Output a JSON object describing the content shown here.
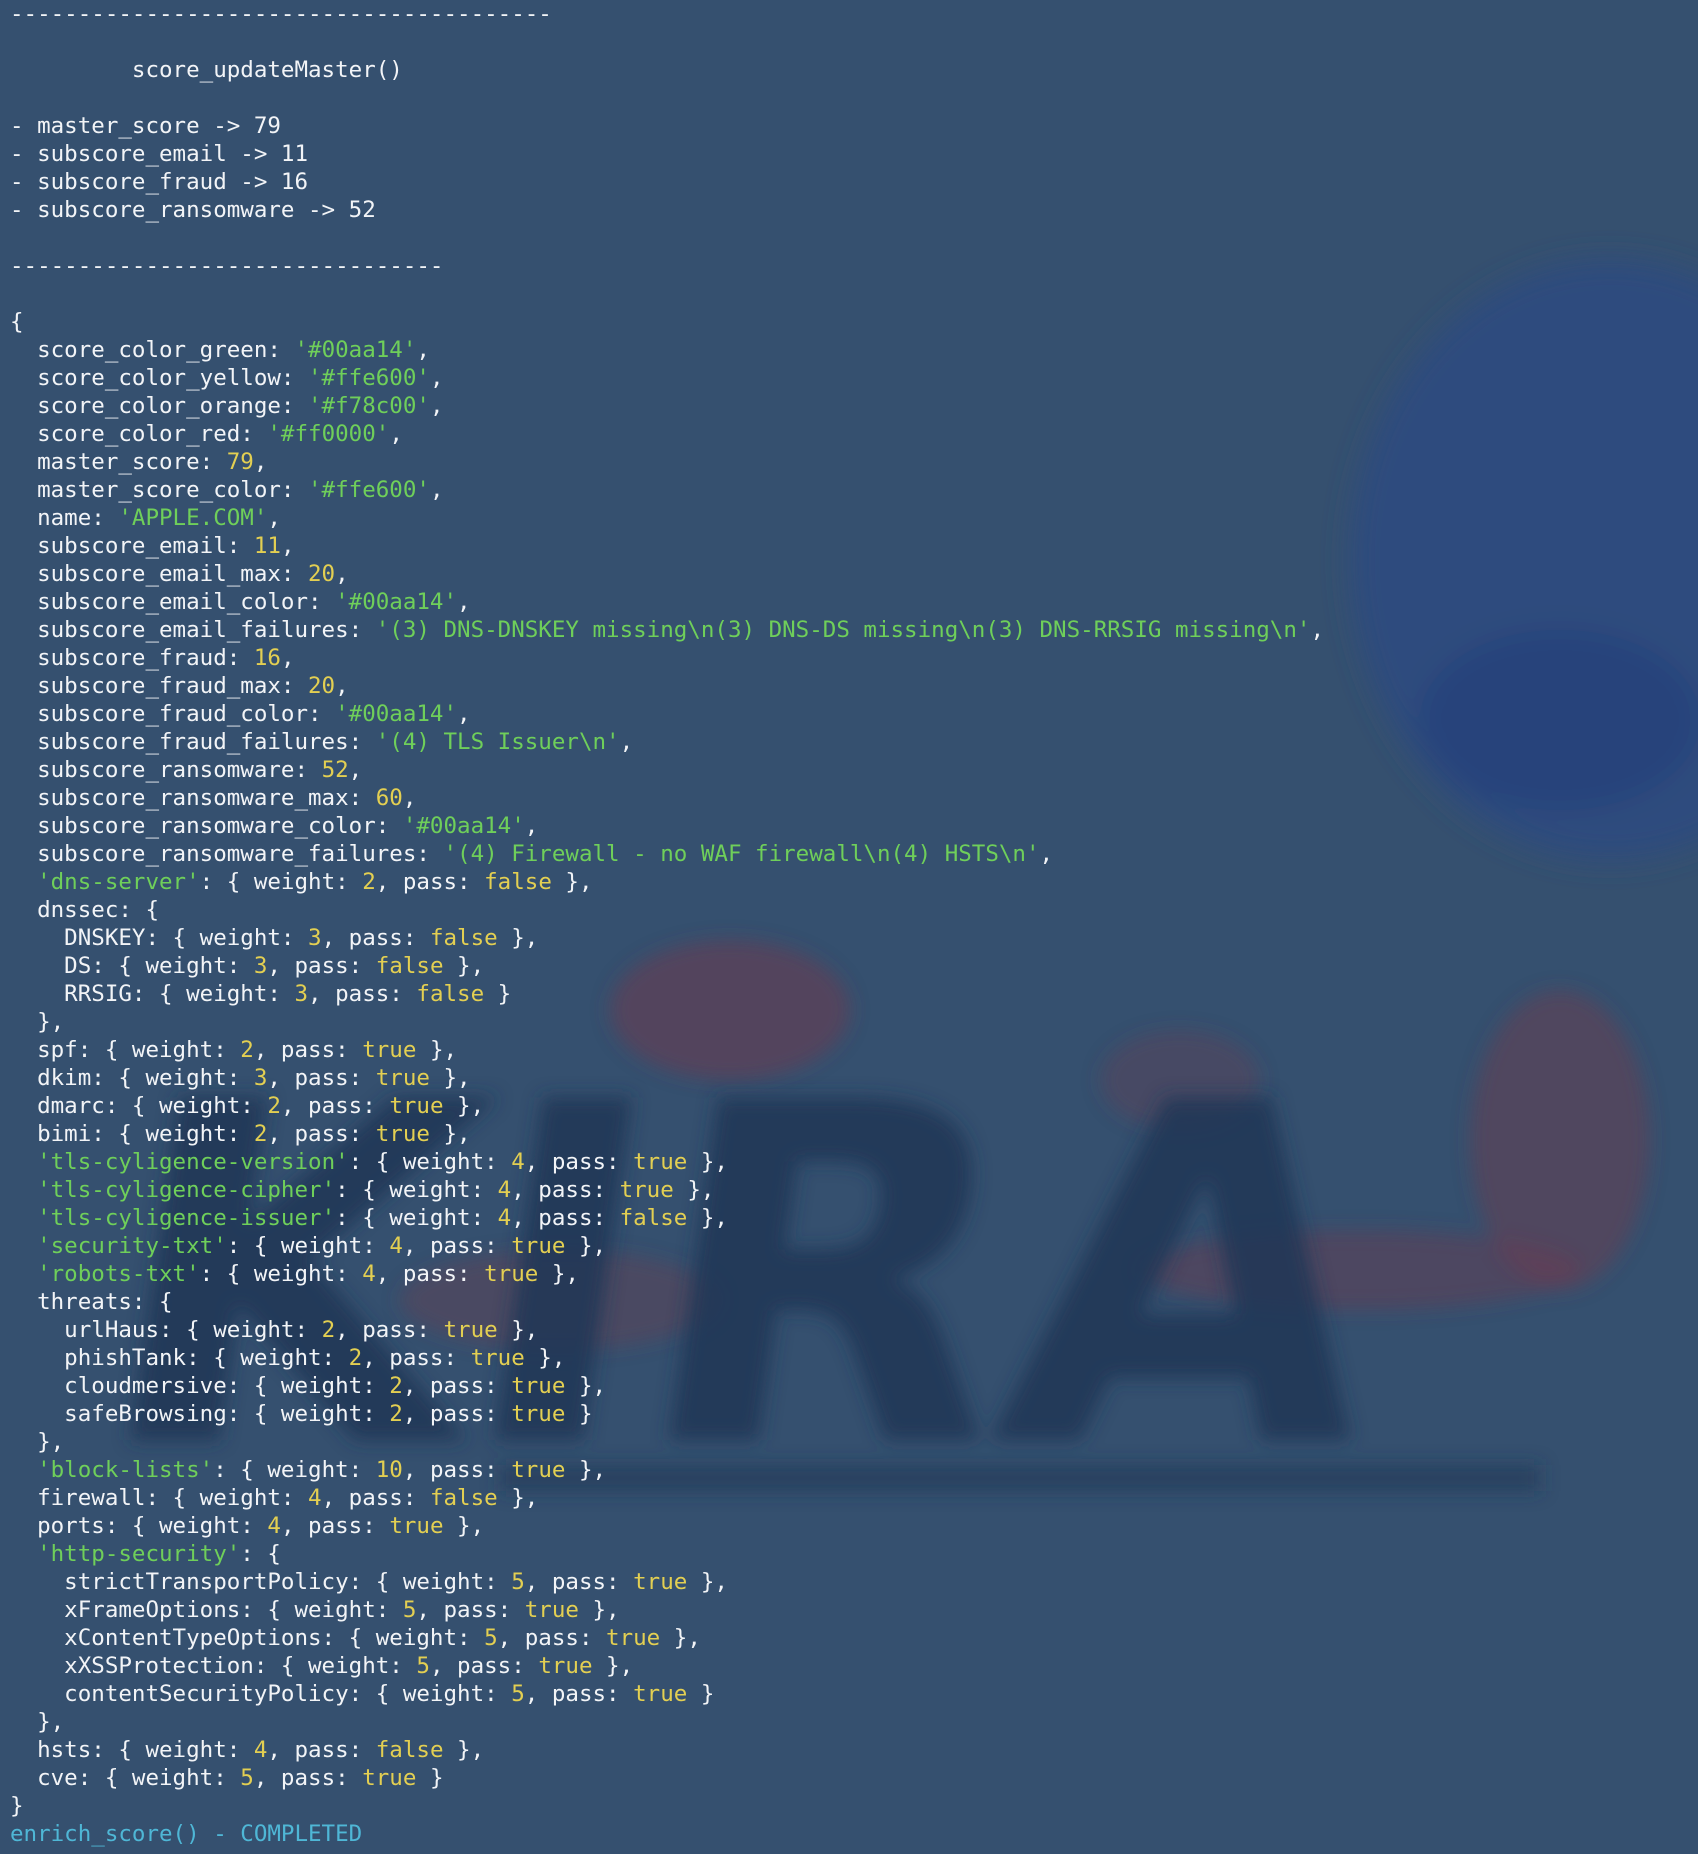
{
  "background": {
    "color": "#35506f",
    "watermark_text": "KIRA"
  },
  "colors": {
    "text": "#f2f4f7",
    "string": "#6fcf5a",
    "number": "#e3cf52",
    "status": "#4fb7d6"
  },
  "lines": [
    {
      "segments": [
        {
          "t": "punc",
          "v": "----------------------------------------"
        }
      ]
    },
    {
      "segments": [
        {
          "t": "punc",
          "v": "         score_updateMaster()"
        }
      ]
    },
    {
      "segments": [
        {
          "t": "punc",
          "v": "- master_score -> 79"
        }
      ]
    },
    {
      "segments": [
        {
          "t": "punc",
          "v": "- subscore_email -> 11"
        }
      ]
    },
    {
      "segments": [
        {
          "t": "punc",
          "v": "- subscore_fraud -> 16"
        }
      ]
    },
    {
      "segments": [
        {
          "t": "punc",
          "v": "- subscore_ransomware -> 52"
        }
      ]
    },
    {
      "segments": [
        {
          "t": "punc",
          "v": "--------------------------------"
        }
      ]
    },
    {
      "segments": [
        {
          "t": "punc",
          "v": "{"
        }
      ]
    },
    {
      "segments": [
        {
          "t": "key",
          "v": "  score_color_green: "
        },
        {
          "t": "str",
          "v": "'#00aa14'"
        },
        {
          "t": "punc",
          "v": ","
        }
      ]
    },
    {
      "segments": [
        {
          "t": "key",
          "v": "  score_color_yellow: "
        },
        {
          "t": "str",
          "v": "'#ffe600'"
        },
        {
          "t": "punc",
          "v": ","
        }
      ]
    },
    {
      "segments": [
        {
          "t": "key",
          "v": "  score_color_orange: "
        },
        {
          "t": "str",
          "v": "'#f78c00'"
        },
        {
          "t": "punc",
          "v": ","
        }
      ]
    },
    {
      "segments": [
        {
          "t": "key",
          "v": "  score_color_red: "
        },
        {
          "t": "str",
          "v": "'#ff0000'"
        },
        {
          "t": "punc",
          "v": ","
        }
      ]
    },
    {
      "segments": [
        {
          "t": "key",
          "v": "  master_score: "
        },
        {
          "t": "num",
          "v": "79"
        },
        {
          "t": "punc",
          "v": ","
        }
      ]
    },
    {
      "segments": [
        {
          "t": "key",
          "v": "  master_score_color: "
        },
        {
          "t": "str",
          "v": "'#ffe600'"
        },
        {
          "t": "punc",
          "v": ","
        }
      ]
    },
    {
      "segments": [
        {
          "t": "key",
          "v": "  name: "
        },
        {
          "t": "str",
          "v": "'APPLE.COM'"
        },
        {
          "t": "punc",
          "v": ","
        }
      ]
    },
    {
      "segments": [
        {
          "t": "key",
          "v": "  subscore_email: "
        },
        {
          "t": "num",
          "v": "11"
        },
        {
          "t": "punc",
          "v": ","
        }
      ]
    },
    {
      "segments": [
        {
          "t": "key",
          "v": "  subscore_email_max: "
        },
        {
          "t": "num",
          "v": "20"
        },
        {
          "t": "punc",
          "v": ","
        }
      ]
    },
    {
      "segments": [
        {
          "t": "key",
          "v": "  subscore_email_color: "
        },
        {
          "t": "str",
          "v": "'#00aa14'"
        },
        {
          "t": "punc",
          "v": ","
        }
      ]
    },
    {
      "segments": [
        {
          "t": "key",
          "v": "  subscore_email_failures: "
        },
        {
          "t": "str",
          "v": "'(3) DNS-DNSKEY missing\\n(3) DNS-DS missing\\n(3) DNS-RRSIG missing\\n'"
        },
        {
          "t": "punc",
          "v": ","
        }
      ]
    },
    {
      "segments": [
        {
          "t": "key",
          "v": "  subscore_fraud: "
        },
        {
          "t": "num",
          "v": "16"
        },
        {
          "t": "punc",
          "v": ","
        }
      ]
    },
    {
      "segments": [
        {
          "t": "key",
          "v": "  subscore_fraud_max: "
        },
        {
          "t": "num",
          "v": "20"
        },
        {
          "t": "punc",
          "v": ","
        }
      ]
    },
    {
      "segments": [
        {
          "t": "key",
          "v": "  subscore_fraud_color: "
        },
        {
          "t": "str",
          "v": "'#00aa14'"
        },
        {
          "t": "punc",
          "v": ","
        }
      ]
    },
    {
      "segments": [
        {
          "t": "key",
          "v": "  subscore_fraud_failures: "
        },
        {
          "t": "str",
          "v": "'(4) TLS Issuer\\n'"
        },
        {
          "t": "punc",
          "v": ","
        }
      ]
    },
    {
      "segments": [
        {
          "t": "key",
          "v": "  subscore_ransomware: "
        },
        {
          "t": "num",
          "v": "52"
        },
        {
          "t": "punc",
          "v": ","
        }
      ]
    },
    {
      "segments": [
        {
          "t": "key",
          "v": "  subscore_ransomware_max: "
        },
        {
          "t": "num",
          "v": "60"
        },
        {
          "t": "punc",
          "v": ","
        }
      ]
    },
    {
      "segments": [
        {
          "t": "key",
          "v": "  subscore_ransomware_color: "
        },
        {
          "t": "str",
          "v": "'#00aa14'"
        },
        {
          "t": "punc",
          "v": ","
        }
      ]
    },
    {
      "segments": [
        {
          "t": "key",
          "v": "  subscore_ransomware_failures: "
        },
        {
          "t": "str",
          "v": "'(4) Firewall - no WAF firewall\\n(4) HSTS\\n'"
        },
        {
          "t": "punc",
          "v": ","
        }
      ]
    },
    {
      "segments": [
        {
          "t": "key",
          "v": "  "
        },
        {
          "t": "str",
          "v": "'dns-server'"
        },
        {
          "t": "punc",
          "v": ": { weight: "
        },
        {
          "t": "num",
          "v": "2"
        },
        {
          "t": "punc",
          "v": ", pass: "
        },
        {
          "t": "bool",
          "v": "false"
        },
        {
          "t": "punc",
          "v": " },"
        }
      ]
    },
    {
      "segments": [
        {
          "t": "key",
          "v": "  dnssec: {"
        }
      ]
    },
    {
      "segments": [
        {
          "t": "key",
          "v": "    DNSKEY: { weight: "
        },
        {
          "t": "num",
          "v": "3"
        },
        {
          "t": "punc",
          "v": ", pass: "
        },
        {
          "t": "bool",
          "v": "false"
        },
        {
          "t": "punc",
          "v": " },"
        }
      ]
    },
    {
      "segments": [
        {
          "t": "key",
          "v": "    DS: { weight: "
        },
        {
          "t": "num",
          "v": "3"
        },
        {
          "t": "punc",
          "v": ", pass: "
        },
        {
          "t": "bool",
          "v": "false"
        },
        {
          "t": "punc",
          "v": " },"
        }
      ]
    },
    {
      "segments": [
        {
          "t": "key",
          "v": "    RRSIG: { weight: "
        },
        {
          "t": "num",
          "v": "3"
        },
        {
          "t": "punc",
          "v": ", pass: "
        },
        {
          "t": "bool",
          "v": "false"
        },
        {
          "t": "punc",
          "v": " }"
        }
      ]
    },
    {
      "segments": [
        {
          "t": "punc",
          "v": "  },"
        }
      ]
    },
    {
      "segments": [
        {
          "t": "key",
          "v": "  spf: { weight: "
        },
        {
          "t": "num",
          "v": "2"
        },
        {
          "t": "punc",
          "v": ", pass: "
        },
        {
          "t": "bool",
          "v": "true"
        },
        {
          "t": "punc",
          "v": " },"
        }
      ]
    },
    {
      "segments": [
        {
          "t": "key",
          "v": "  dkim: { weight: "
        },
        {
          "t": "num",
          "v": "3"
        },
        {
          "t": "punc",
          "v": ", pass: "
        },
        {
          "t": "bool",
          "v": "true"
        },
        {
          "t": "punc",
          "v": " },"
        }
      ]
    },
    {
      "segments": [
        {
          "t": "key",
          "v": "  dmarc: { weight: "
        },
        {
          "t": "num",
          "v": "2"
        },
        {
          "t": "punc",
          "v": ", pass: "
        },
        {
          "t": "bool",
          "v": "true"
        },
        {
          "t": "punc",
          "v": " },"
        }
      ]
    },
    {
      "segments": [
        {
          "t": "key",
          "v": "  bimi: { weight: "
        },
        {
          "t": "num",
          "v": "2"
        },
        {
          "t": "punc",
          "v": ", pass: "
        },
        {
          "t": "bool",
          "v": "true"
        },
        {
          "t": "punc",
          "v": " },"
        }
      ]
    },
    {
      "segments": [
        {
          "t": "key",
          "v": "  "
        },
        {
          "t": "str",
          "v": "'tls-cyligence-version'"
        },
        {
          "t": "punc",
          "v": ": { weight: "
        },
        {
          "t": "num",
          "v": "4"
        },
        {
          "t": "punc",
          "v": ", pass: "
        },
        {
          "t": "bool",
          "v": "true"
        },
        {
          "t": "punc",
          "v": " },"
        }
      ]
    },
    {
      "segments": [
        {
          "t": "key",
          "v": "  "
        },
        {
          "t": "str",
          "v": "'tls-cyligence-cipher'"
        },
        {
          "t": "punc",
          "v": ": { weight: "
        },
        {
          "t": "num",
          "v": "4"
        },
        {
          "t": "punc",
          "v": ", pass: "
        },
        {
          "t": "bool",
          "v": "true"
        },
        {
          "t": "punc",
          "v": " },"
        }
      ]
    },
    {
      "segments": [
        {
          "t": "key",
          "v": "  "
        },
        {
          "t": "str",
          "v": "'tls-cyligence-issuer'"
        },
        {
          "t": "punc",
          "v": ": { weight: "
        },
        {
          "t": "num",
          "v": "4"
        },
        {
          "t": "punc",
          "v": ", pass: "
        },
        {
          "t": "bool",
          "v": "false"
        },
        {
          "t": "punc",
          "v": " },"
        }
      ]
    },
    {
      "segments": [
        {
          "t": "key",
          "v": "  "
        },
        {
          "t": "str",
          "v": "'security-txt'"
        },
        {
          "t": "punc",
          "v": ": { weight: "
        },
        {
          "t": "num",
          "v": "4"
        },
        {
          "t": "punc",
          "v": ", pass: "
        },
        {
          "t": "bool",
          "v": "true"
        },
        {
          "t": "punc",
          "v": " },"
        }
      ]
    },
    {
      "segments": [
        {
          "t": "key",
          "v": "  "
        },
        {
          "t": "str",
          "v": "'robots-txt'"
        },
        {
          "t": "punc",
          "v": ": { weight: "
        },
        {
          "t": "num",
          "v": "4"
        },
        {
          "t": "punc",
          "v": ", pass: "
        },
        {
          "t": "bool",
          "v": "true"
        },
        {
          "t": "punc",
          "v": " },"
        }
      ]
    },
    {
      "segments": [
        {
          "t": "key",
          "v": "  threats: {"
        }
      ]
    },
    {
      "segments": [
        {
          "t": "key",
          "v": "    urlHaus: { weight: "
        },
        {
          "t": "num",
          "v": "2"
        },
        {
          "t": "punc",
          "v": ", pass: "
        },
        {
          "t": "bool",
          "v": "true"
        },
        {
          "t": "punc",
          "v": " },"
        }
      ]
    },
    {
      "segments": [
        {
          "t": "key",
          "v": "    phishTank: { weight: "
        },
        {
          "t": "num",
          "v": "2"
        },
        {
          "t": "punc",
          "v": ", pass: "
        },
        {
          "t": "bool",
          "v": "true"
        },
        {
          "t": "punc",
          "v": " },"
        }
      ]
    },
    {
      "segments": [
        {
          "t": "key",
          "v": "    cloudmersive: { weight: "
        },
        {
          "t": "num",
          "v": "2"
        },
        {
          "t": "punc",
          "v": ", pass: "
        },
        {
          "t": "bool",
          "v": "true"
        },
        {
          "t": "punc",
          "v": " },"
        }
      ]
    },
    {
      "segments": [
        {
          "t": "key",
          "v": "    safeBrowsing: { weight: "
        },
        {
          "t": "num",
          "v": "2"
        },
        {
          "t": "punc",
          "v": ", pass: "
        },
        {
          "t": "bool",
          "v": "true"
        },
        {
          "t": "punc",
          "v": " }"
        }
      ]
    },
    {
      "segments": [
        {
          "t": "punc",
          "v": "  },"
        }
      ]
    },
    {
      "segments": [
        {
          "t": "key",
          "v": "  "
        },
        {
          "t": "str",
          "v": "'block-lists'"
        },
        {
          "t": "punc",
          "v": ": { weight: "
        },
        {
          "t": "num",
          "v": "10"
        },
        {
          "t": "punc",
          "v": ", pass: "
        },
        {
          "t": "bool",
          "v": "true"
        },
        {
          "t": "punc",
          "v": " },"
        }
      ]
    },
    {
      "segments": [
        {
          "t": "key",
          "v": "  firewall: { weight: "
        },
        {
          "t": "num",
          "v": "4"
        },
        {
          "t": "punc",
          "v": ", pass: "
        },
        {
          "t": "bool",
          "v": "false"
        },
        {
          "t": "punc",
          "v": " },"
        }
      ]
    },
    {
      "segments": [
        {
          "t": "key",
          "v": "  ports: { weight: "
        },
        {
          "t": "num",
          "v": "4"
        },
        {
          "t": "punc",
          "v": ", pass: "
        },
        {
          "t": "bool",
          "v": "true"
        },
        {
          "t": "punc",
          "v": " },"
        }
      ]
    },
    {
      "segments": [
        {
          "t": "key",
          "v": "  "
        },
        {
          "t": "str",
          "v": "'http-security'"
        },
        {
          "t": "punc",
          "v": ": {"
        }
      ]
    },
    {
      "segments": [
        {
          "t": "key",
          "v": "    strictTransportPolicy: { weight: "
        },
        {
          "t": "num",
          "v": "5"
        },
        {
          "t": "punc",
          "v": ", pass: "
        },
        {
          "t": "bool",
          "v": "true"
        },
        {
          "t": "punc",
          "v": " },"
        }
      ]
    },
    {
      "segments": [
        {
          "t": "key",
          "v": "    xFrameOptions: { weight: "
        },
        {
          "t": "num",
          "v": "5"
        },
        {
          "t": "punc",
          "v": ", pass: "
        },
        {
          "t": "bool",
          "v": "true"
        },
        {
          "t": "punc",
          "v": " },"
        }
      ]
    },
    {
      "segments": [
        {
          "t": "key",
          "v": "    xContentTypeOptions: { weight: "
        },
        {
          "t": "num",
          "v": "5"
        },
        {
          "t": "punc",
          "v": ", pass: "
        },
        {
          "t": "bool",
          "v": "true"
        },
        {
          "t": "punc",
          "v": " },"
        }
      ]
    },
    {
      "segments": [
        {
          "t": "key",
          "v": "    xXSSProtection: { weight: "
        },
        {
          "t": "num",
          "v": "5"
        },
        {
          "t": "punc",
          "v": ", pass: "
        },
        {
          "t": "bool",
          "v": "true"
        },
        {
          "t": "punc",
          "v": " },"
        }
      ]
    },
    {
      "segments": [
        {
          "t": "key",
          "v": "    contentSecurityPolicy: { weight: "
        },
        {
          "t": "num",
          "v": "5"
        },
        {
          "t": "punc",
          "v": ", pass: "
        },
        {
          "t": "bool",
          "v": "true"
        },
        {
          "t": "punc",
          "v": " }"
        }
      ]
    },
    {
      "segments": [
        {
          "t": "punc",
          "v": "  },"
        }
      ]
    },
    {
      "segments": [
        {
          "t": "key",
          "v": "  hsts: { weight: "
        },
        {
          "t": "num",
          "v": "4"
        },
        {
          "t": "punc",
          "v": ", pass: "
        },
        {
          "t": "bool",
          "v": "false"
        },
        {
          "t": "punc",
          "v": " },"
        }
      ]
    },
    {
      "segments": [
        {
          "t": "key",
          "v": "  cve: { weight: "
        },
        {
          "t": "num",
          "v": "5"
        },
        {
          "t": "punc",
          "v": ", pass: "
        },
        {
          "t": "bool",
          "v": "true"
        },
        {
          "t": "punc",
          "v": " }"
        }
      ]
    },
    {
      "segments": [
        {
          "t": "punc",
          "v": "}"
        }
      ]
    },
    {
      "segments": [
        {
          "t": "cyan",
          "v": "enrich_score() - COMPLETED"
        }
      ]
    }
  ]
}
